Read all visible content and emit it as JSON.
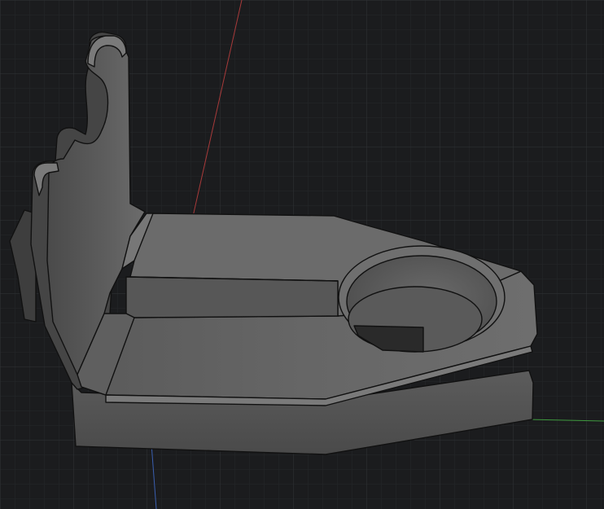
{
  "viewport": {
    "background": "#1b1c1e",
    "grid_minor_color": "#26282b",
    "grid_major_color": "#3a3d41",
    "axis_x_color": "#3f9a3f",
    "axis_y_color": "#a83a3a",
    "axis_z_color": "#3a5fb0"
  },
  "model": {
    "face_top": "#6a6a6a",
    "face_mid": "#595959",
    "face_dark": "#474747",
    "face_side": "#555555",
    "edge_color": "#111111",
    "highlight": "#8a8a8a",
    "hole_inner": "#5e5e5e",
    "hole_slot": "#2a2a2a"
  }
}
